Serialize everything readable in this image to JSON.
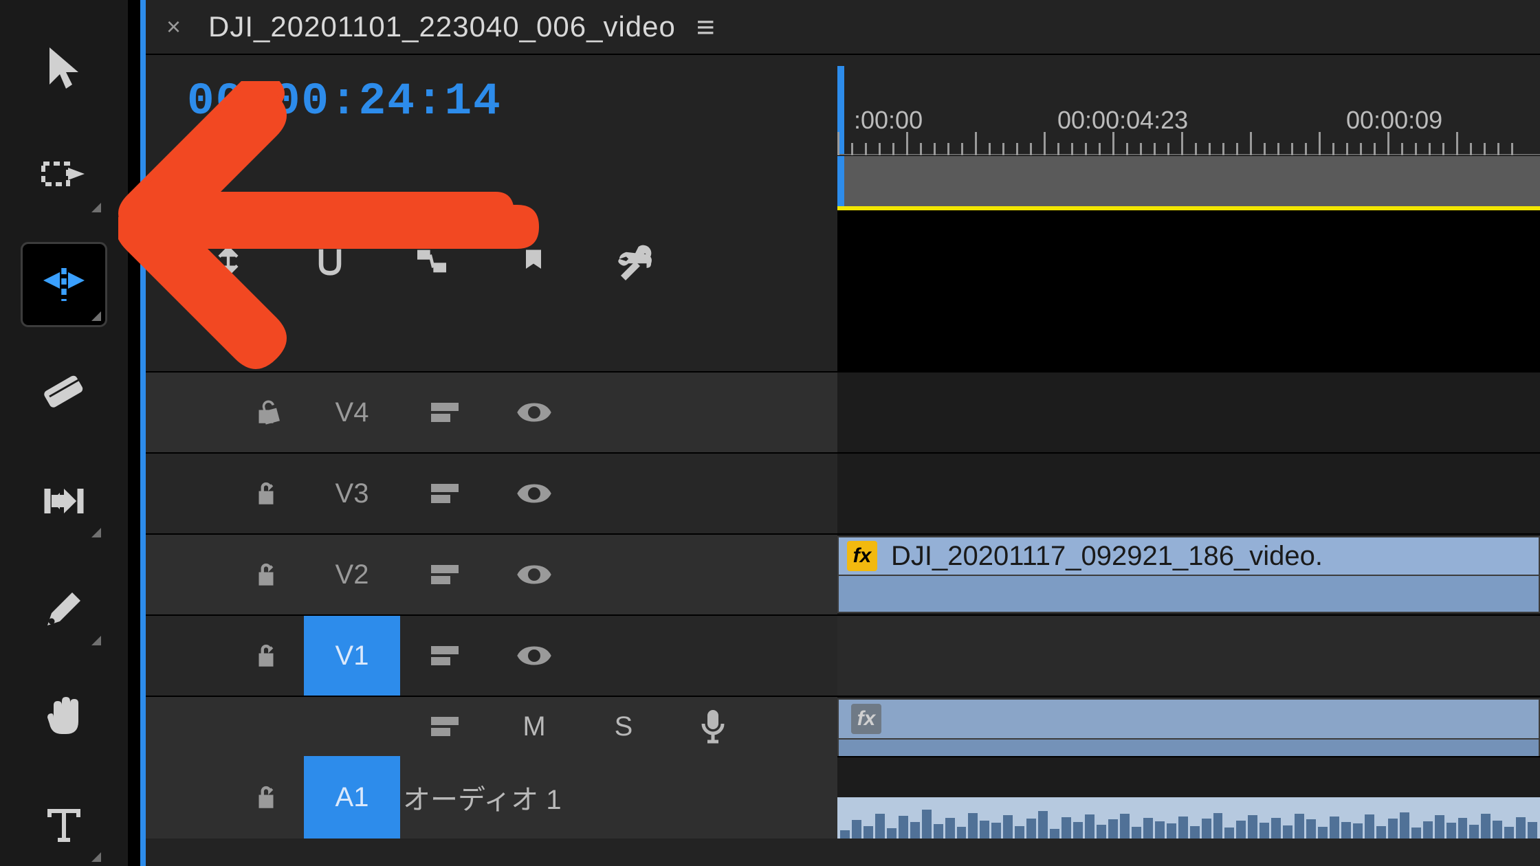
{
  "tab": {
    "title": "DJI_20201101_223040_006_video",
    "close": "×",
    "menu": "≡"
  },
  "timecode": "00:00:24:14",
  "ruler": {
    "labels": [
      ":00:00",
      "00:00:04:23",
      "00:00:09"
    ],
    "positions": [
      24,
      410,
      840
    ]
  },
  "tracks": {
    "video": [
      {
        "label": "V4",
        "selected": false
      },
      {
        "label": "V3",
        "selected": false
      },
      {
        "label": "V2",
        "selected": false
      },
      {
        "label": "V1",
        "selected": true
      }
    ],
    "audio": {
      "label": "A1",
      "name": "オーディオ 1",
      "mute": "M",
      "solo": "S"
    }
  },
  "clips": {
    "v2": {
      "name": "DJI_20201117_092921_186_video.",
      "fx": "fx"
    },
    "a1": {
      "fx": "fx"
    }
  },
  "tools": [
    "selection-tool",
    "track-select-tool",
    "ripple-edit-tool",
    "razor-tool",
    "slip-tool",
    "pen-tool",
    "hand-tool",
    "type-tool"
  ],
  "selected_tool_index": 2
}
